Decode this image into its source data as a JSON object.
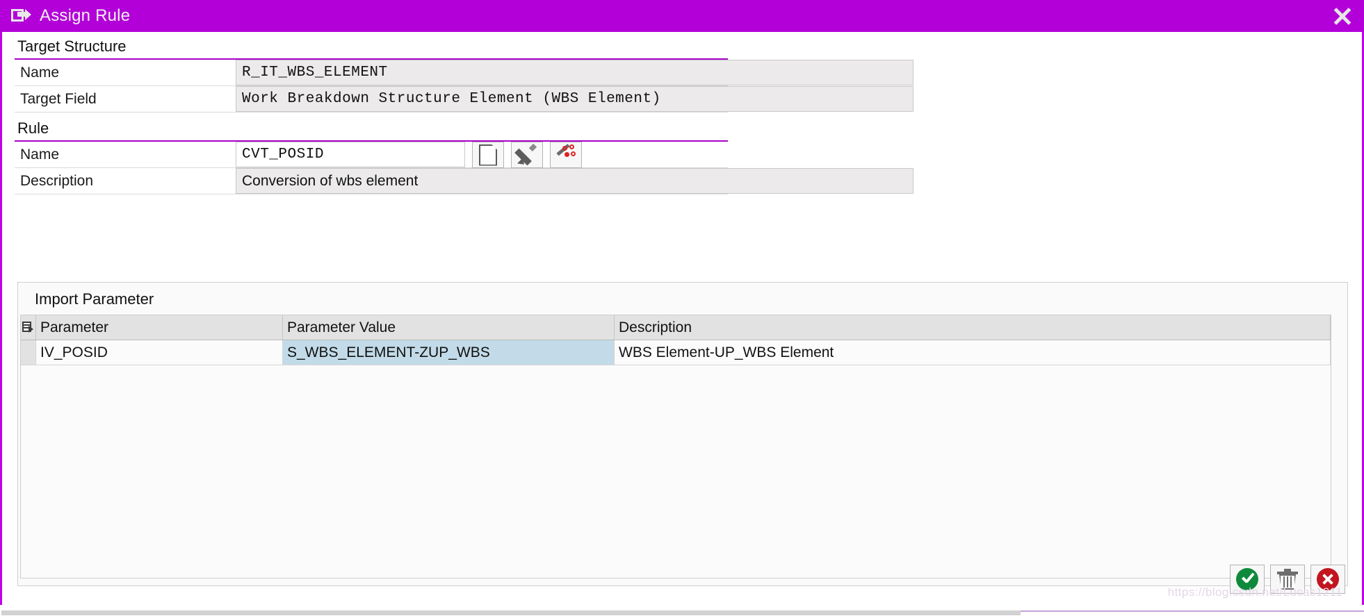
{
  "window": {
    "title": "Assign Rule",
    "title_icon": "assign-rule-icon",
    "close_icon": "close-icon",
    "accent_color": "#b300d9",
    "section_underline_color": "#a800c8"
  },
  "target_structure": {
    "heading": "Target Structure",
    "rows": [
      {
        "label": "Name",
        "value": "R_IT_WBS_ELEMENT"
      },
      {
        "label": "Target Field",
        "value": "Work Breakdown Structure Element (WBS Element)"
      }
    ]
  },
  "rule": {
    "heading": "Rule",
    "name_label": "Name",
    "name_value": "CVT_POSID",
    "description_label": "Description",
    "description_value": "Conversion of wbs element",
    "buttons": [
      {
        "name": "new-rule-button",
        "icon": "page-icon"
      },
      {
        "name": "edit-rule-button",
        "icon": "pencil-icon"
      },
      {
        "name": "rule-wizard-button",
        "icon": "magic-wand-icon"
      }
    ]
  },
  "import_parameter": {
    "title": "Import Parameter",
    "select_all_icon": "table-select-all-icon",
    "columns": [
      "Parameter",
      "Parameter Value",
      "Description"
    ],
    "rows": [
      {
        "parameter": "IV_POSID",
        "parameter_value": "S_WBS_ELEMENT-ZUP_WBS",
        "description": "WBS Element-UP_WBS Element",
        "value_highlight": "#c3dbe8"
      }
    ]
  },
  "actions": [
    {
      "name": "confirm-button",
      "icon": "green-check-icon",
      "color": "#0f8a3c"
    },
    {
      "name": "delete-button",
      "icon": "trash-icon",
      "color": "#6d6d6d"
    },
    {
      "name": "cancel-button",
      "icon": "red-cancel-icon",
      "color": "#c2151f"
    }
  ],
  "watermark": "https://blog.csdn.net/Lucas1211"
}
